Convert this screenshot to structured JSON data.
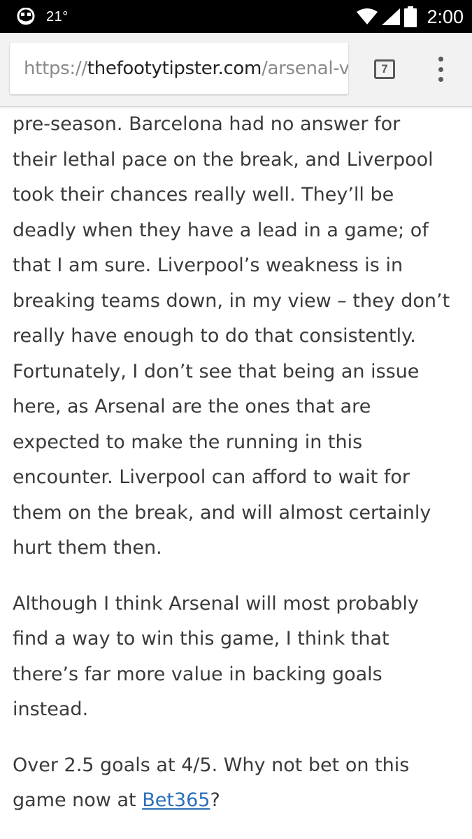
{
  "status_bar": {
    "temperature": "21°",
    "time": "2:00",
    "icons": [
      "notification-app-icon",
      "wifi-icon",
      "signal-icon",
      "battery-icon"
    ]
  },
  "browser": {
    "url_scheme": "https://",
    "url_host": "thefootytipster.com",
    "url_path": "/arsenal-v-liverpool",
    "tab_count": "7",
    "menu_icon": "overflow-menu-icon"
  },
  "article": {
    "paragraph1_lines": [
      "pre-season. Barcelona had no answer for",
      "their lethal pace on the break, and Liverpool",
      "took their chances really well. They’ll be",
      "deadly when they have a lead in a game; of",
      "that I am sure. Liverpool’s weakness is in",
      "breaking teams down, in my view – they don’t",
      "really have enough to do that consistently.",
      "Fortunately, I don’t see that being an issue",
      "here, as Arsenal are the ones that are",
      "expected to make the running in this",
      "encounter. Liverpool can afford to wait for",
      "them on the break, and will almost certainly",
      "hurt them then."
    ],
    "paragraph2_lines": [
      "Although I think Arsenal will most probably",
      "find a way to win this game, I think that",
      "there’s far more value in backing goals",
      "instead."
    ],
    "paragraph3_line1": "Over 2.5 goals at 4/5. Why not bet on this",
    "paragraph3_line2_prefix": "game now at ",
    "paragraph3_link": "Bet365",
    "paragraph3_line2_suffix": "?"
  },
  "colors": {
    "text": "#3a3a3a",
    "link": "#2a6ebb",
    "toolbar_bg": "#f2f2f2",
    "status_bar_bg": "#000000"
  }
}
